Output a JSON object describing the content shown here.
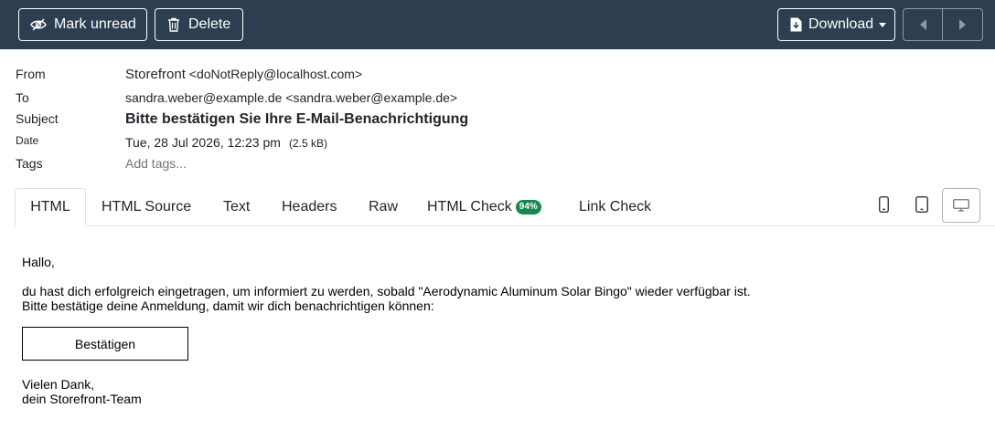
{
  "toolbar": {
    "mark_unread": "Mark unread",
    "delete": "Delete",
    "download": "Download"
  },
  "headers": {
    "from_label": "From",
    "from_name": "Storefront",
    "from_email": "<doNotReply@localhost.com>",
    "to_label": "To",
    "to_value": "sandra.weber@example.de <sandra.weber@example.de>",
    "subject_label": "Subject",
    "subject_value": "Bitte bestätigen Sie Ihre E-Mail-Benachrichtigung",
    "date_label": "Date",
    "date_value": "Tue, 28 Jul 2026, 12:23 pm",
    "size_value": "(2.5 kB)",
    "tags_label": "Tags",
    "tags_placeholder": "Add tags..."
  },
  "tabs": [
    {
      "label": "HTML"
    },
    {
      "label": "HTML Source"
    },
    {
      "label": "Text"
    },
    {
      "label": "Headers"
    },
    {
      "label": "Raw"
    },
    {
      "label": "HTML Check",
      "badge": "94%"
    },
    {
      "label": "Link Check"
    }
  ],
  "icons": {
    "mark_unread": "eye-slash-icon",
    "delete": "trash-icon",
    "download": "download-icon",
    "prev": "prev-arrow-icon",
    "next": "next-arrow-icon",
    "phone": "phone-icon",
    "tablet": "tablet-icon",
    "desktop": "desktop-icon"
  },
  "colors": {
    "toolbar_bg": "#2c3e50",
    "badge_bg": "#198754"
  },
  "message": {
    "greeting": "Hallo,",
    "line1": "du hast dich erfolgreich eingetragen, um informiert zu werden, sobald \"Aerodynamic Aluminum Solar Bingo\" wieder verfügbar ist.",
    "line2": "Bitte bestätige deine Anmeldung, damit wir dich benachrichtigen können:",
    "button": "Bestätigen",
    "closing1": "Vielen Dank,",
    "closing2": "dein Storefront-Team"
  }
}
